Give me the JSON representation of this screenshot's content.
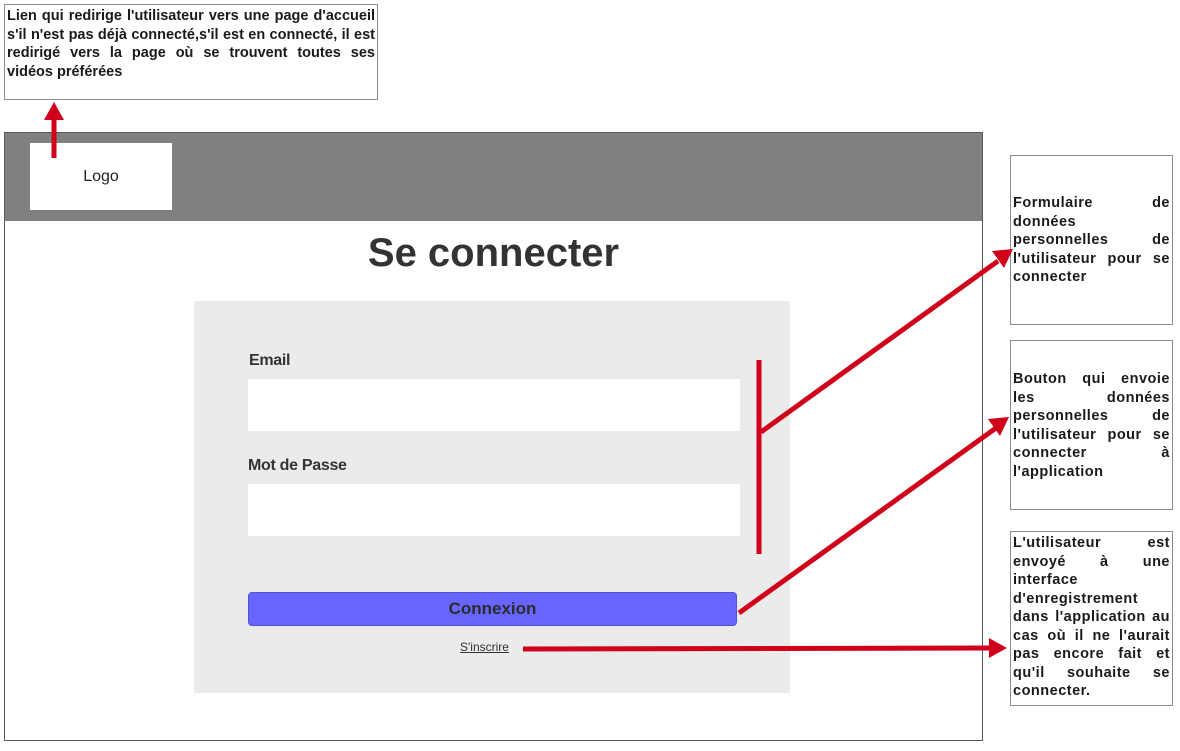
{
  "notes": {
    "logo_note": "Lien qui redirige l'utilisateur vers une page d'accueil s'il n'est pas déjà connecté,s'il est en connecté, il est redirigé vers la page où se trouvent toutes ses vidéos préférées",
    "form_note": "Formulaire de données personnelles de l'utilisateur pour se connecter",
    "button_note": "Bouton qui envoie les données personnelles de l'utilisateur pour se connecter à l'application",
    "register_note": "L'utilisateur est envoyé à une interface d'enregistrement dans l'application au cas où il ne l'aurait pas encore fait et qu'il souhaite se connecter."
  },
  "header": {
    "logo_label": "Logo"
  },
  "main": {
    "title": "Se connecter",
    "email_label": "Email",
    "email_value": "",
    "password_label": "Mot de Passe",
    "password_value": "",
    "submit_label": "Connexion",
    "register_link": "S'inscrire"
  },
  "colors": {
    "arrow": "#d0021b",
    "header_bar": "#808080",
    "form_panel": "#ebebeb",
    "button": "#6666ff"
  }
}
